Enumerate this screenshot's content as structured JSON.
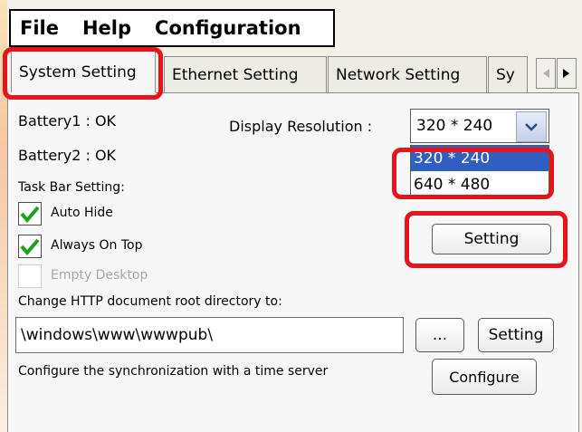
{
  "menu": {
    "items": [
      "File",
      "Help",
      "Configuration"
    ]
  },
  "tabs": [
    {
      "label": "System Setting",
      "active": true
    },
    {
      "label": "Ethernet Setting",
      "active": false
    },
    {
      "label": "Network Setting",
      "active": false
    },
    {
      "label": "Sy",
      "active": false
    }
  ],
  "tab_scroll": {
    "left_icon": "chevron-left-icon",
    "right_icon": "chevron-right-icon"
  },
  "system": {
    "battery1": "Battery1 : OK",
    "battery2": "Battery2 : OK",
    "display_resolution_label": "Display Resolution :",
    "resolution_selected": "320 * 240",
    "resolution_options": [
      "320 * 240",
      "640 * 480"
    ],
    "resolution_setting_button": "Setting",
    "taskbar_label": "Task Bar Setting:",
    "checkboxes": [
      {
        "label": "Auto Hide",
        "checked": true,
        "enabled": true
      },
      {
        "label": "Always On Top",
        "checked": true,
        "enabled": true
      },
      {
        "label": "Empty Desktop",
        "checked": false,
        "enabled": false
      }
    ],
    "http_root_label": "Change HTTP document root directory to:",
    "http_root_value": "\\windows\\www\\wwwpub\\",
    "browse_button": "...",
    "http_setting_button": "Setting",
    "time_sync_label": "Configure the synchronization with a time server",
    "configure_button": "Configure"
  },
  "colors": {
    "highlight": "#e8141b",
    "check": "#19a319",
    "selected_option": "#2f5fc0"
  }
}
